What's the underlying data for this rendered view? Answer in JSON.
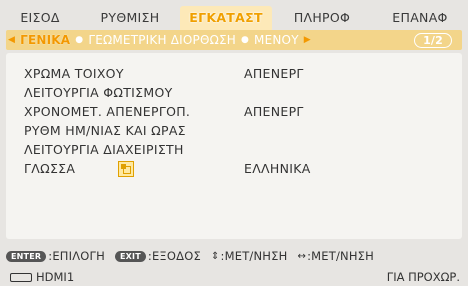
{
  "tabs": [
    "ΕΙΣΟΔ",
    "ΡΥΘΜΙΣΗ",
    "ΕΓΚΑΤΑΣΤ",
    "ΠΛΗΡΟΦ",
    "ΕΠΑΝΑΦ"
  ],
  "subtabs": [
    "ΓΕΝΙΚΑ",
    "ΓΕΩΜΕΤΡΙΚΗ ΔΙΟΡΘΩΣΗ",
    "ΜΕΝΟΥ"
  ],
  "page_indicator": "1/2",
  "rows": [
    {
      "label": "ΧΡΩΜΑ ΤΟΙΧΟΥ",
      "value": "ΑΠΕΝΕΡΓ"
    },
    {
      "label": "ΛΕΙΤΟΥΡΓΙΑ ΦΩΤΙΣΜΟΥ",
      "value": ""
    },
    {
      "label": "ΧΡΟΝΟΜΕΤ. ΑΠΕΝΕΡΓΟΠ.",
      "value": "ΑΠΕΝΕΡΓ"
    },
    {
      "label": "ΡΥΘΜ ΗΜ/ΝΙΑΣ ΚΑΙ ΩΡΑΣ",
      "value": ""
    },
    {
      "label": "ΛΕΙΤΟΥΡΓΙΑ ΔΙΑΧΕΙΡΙΣΤΗ",
      "value": ""
    },
    {
      "label": "ΓΛΩΣΣΑ",
      "value": "ΕΛΛΗΝΙΚΑ"
    }
  ],
  "hints": {
    "enter_key": "ENTER",
    "enter_label": ":ΕΠΙΛΟΓΗ",
    "exit_key": "EXIT",
    "exit_label": ":ΕΞΟΔΟΣ",
    "move_v_glyph": "⇕",
    "move_v_label": ":ΜΕΤ/ΝΗΣΗ",
    "move_h_glyph": "↔",
    "move_h_label": ":ΜΕΤ/ΝΗΣΗ"
  },
  "status": {
    "source": "HDMI1",
    "right_text": "ΓΙΑ ΠΡΟΧΩΡ."
  },
  "colors": {
    "active_tab_text": "#f0a000",
    "subbar_bg": "#f3d58a"
  }
}
